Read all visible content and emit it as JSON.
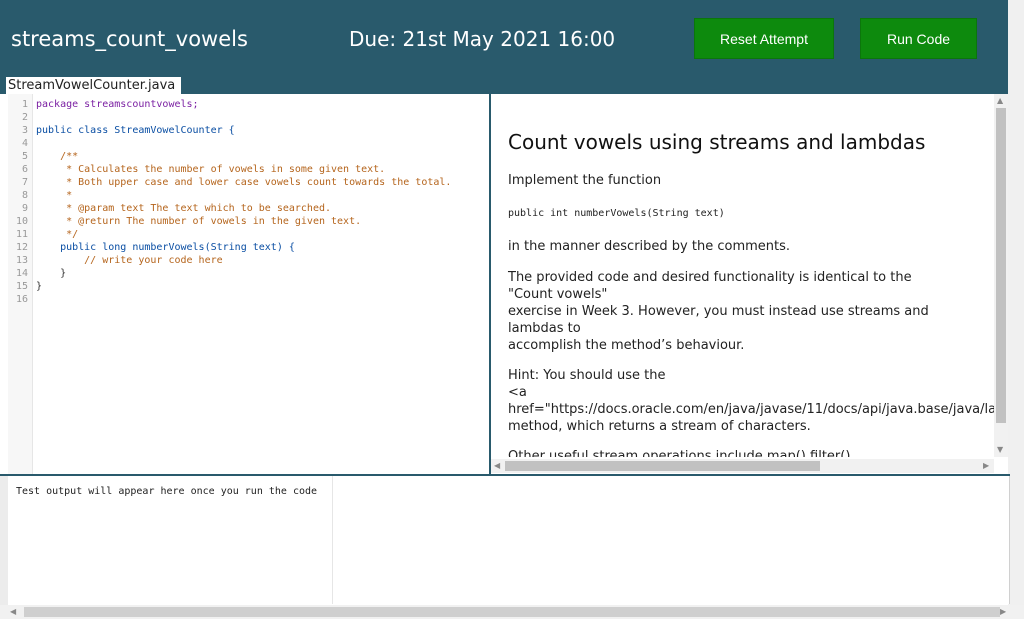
{
  "header": {
    "exercise_title": "streams_count_vowels",
    "due": "Due: 21st May 2021 16:00",
    "reset_label": "Reset Attempt",
    "run_label": "Run Code"
  },
  "file_tab": "StreamVowelCounter.java",
  "editor": {
    "line_numbers": [
      "1",
      "2",
      "3",
      "4",
      "5",
      "6",
      "7",
      "8",
      "9",
      "10",
      "11",
      "12",
      "13",
      "14",
      "15",
      "16"
    ],
    "code": [
      "package streamscountvowels;",
      "",
      "public class StreamVowelCounter {",
      "",
      "    /**",
      "     * Calculates the number of vowels in some given text.",
      "     * Both upper case and lower case vowels count towards the total.",
      "     *",
      "     * @param text The text which to be searched.",
      "     * @return The number of vowels in the given text.",
      "     */",
      "    public long numberVowels(String text) {",
      "        // write your code here",
      "    }",
      "}",
      ""
    ]
  },
  "description": {
    "heading": "Count vowels using streams and lambdas",
    "p1": "Implement the function",
    "signature": "public int numberVowels(String text)",
    "p2": "in the manner described by the comments.",
    "p3_l1": "The provided code and desired functionality is identical to the",
    "p3_l2": "\"Count vowels\"",
    "p3_l3": "exercise in Week 3. However, you must instead use streams and",
    "p3_l4": "lambdas to",
    "p3_l5": "accomplish the method’s behaviour.",
    "hint_l1": "Hint: You should use the",
    "hint_l2": "<a",
    "hint_l3": "href=\"https://docs.oracle.com/en/java/javase/11/docs/api/java.base/java/la",
    "hint_l4": "method, which returns a stream of characters.",
    "other_l1": "Other useful stream operations include map() filter()"
  },
  "output": {
    "placeholder": "Test output will appear here once you run the code"
  }
}
